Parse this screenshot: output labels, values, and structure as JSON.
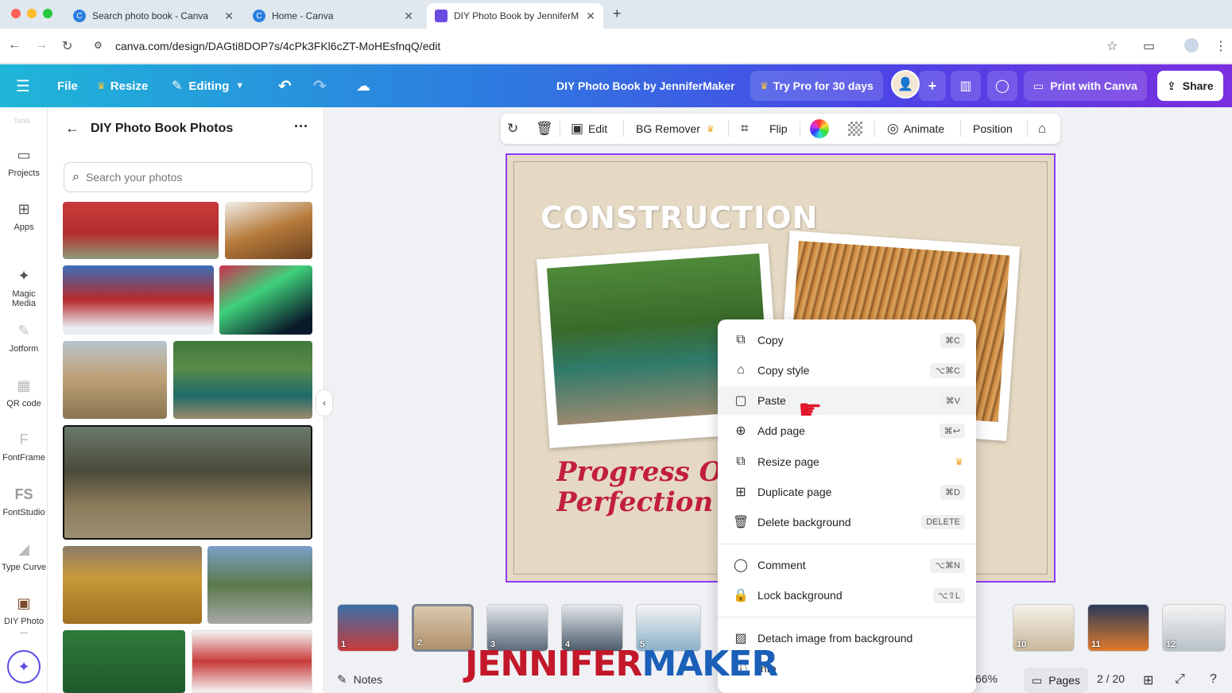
{
  "browser": {
    "tabs": [
      {
        "title": "Search photo book - Canva"
      },
      {
        "title": "Home - Canva"
      },
      {
        "title": "DIY Photo Book by JenniferM"
      }
    ],
    "url": "canva.com/design/DAGti8DOP7s/4cPk3FKl6cZT-MoHEsfnqQ/edit"
  },
  "header": {
    "file": "File",
    "resize": "Resize",
    "editing": "Editing",
    "design_title": "DIY Photo Book by JenniferMaker",
    "try_pro": "Try Pro for 30 days",
    "print": "Print with Canva",
    "share": "Share"
  },
  "rail": {
    "tools_label": "Tools",
    "items": [
      {
        "label": "Projects",
        "icon": "folder-icon"
      },
      {
        "label": "Apps",
        "icon": "apps-icon"
      },
      {
        "label": "Magic Media",
        "icon": "magic-media-icon"
      },
      {
        "label": "Jotform",
        "icon": "jotform-icon"
      },
      {
        "label": "QR code",
        "icon": "qr-code-icon"
      },
      {
        "label": "FontFrame",
        "icon": "fontframe-icon"
      },
      {
        "label": "FontStudio",
        "icon": "fontstudio-icon"
      },
      {
        "label": "Type Curve",
        "icon": "type-curve-icon"
      },
      {
        "label": "DIY Photo ...",
        "icon": "diy-photo-icon"
      }
    ]
  },
  "panel": {
    "title": "DIY Photo Book Photos",
    "search_placeholder": "Search your photos"
  },
  "toolbar": {
    "edit": "Edit",
    "bg_remover": "BG Remover",
    "flip": "Flip",
    "animate": "Animate",
    "position": "Position"
  },
  "canvas": {
    "title": "CONSTRUCTION",
    "quote_line1": "Progress Over",
    "quote_line2": "Perfection"
  },
  "context_menu": {
    "items": [
      {
        "label": "Copy",
        "shortcut": "⌘C",
        "icon": "copy-icon"
      },
      {
        "label": "Copy style",
        "shortcut": "⌥⌘C",
        "icon": "paint-roller-icon"
      },
      {
        "label": "Paste",
        "shortcut": "⌘V",
        "icon": "clipboard-icon"
      },
      {
        "label": "Add page",
        "shortcut": "⌘↩",
        "icon": "add-page-icon"
      },
      {
        "label": "Resize page",
        "shortcut": "",
        "icon": "resize-icon"
      },
      {
        "label": "Duplicate page",
        "shortcut": "⌘D",
        "icon": "duplicate-icon"
      },
      {
        "label": "Delete background",
        "shortcut": "DELETE",
        "icon": "trash-icon"
      },
      {
        "label": "Comment",
        "shortcut": "⌥⌘N",
        "icon": "comment-icon"
      },
      {
        "label": "Lock background",
        "shortcut": "⌥⇧L",
        "icon": "lock-icon"
      },
      {
        "label": "Detach image from background",
        "shortcut": "",
        "icon": "detach-icon"
      },
      {
        "label": "Info",
        "shortcut": "",
        "icon": "info-icon"
      }
    ]
  },
  "pages_strip": {
    "numbers": [
      "1",
      "2",
      "3",
      "4",
      "5",
      "10",
      "11",
      "12"
    ]
  },
  "bottom": {
    "notes": "Notes",
    "zoom": "66%",
    "pages": "Pages",
    "page_count": "2 / 20"
  },
  "watermark": {
    "part1": "JENNIFER",
    "part2": "MAKER"
  },
  "colors": {
    "accent": "#8b3dff",
    "quote_red": "#c21f3a",
    "crown": "#f2a31f"
  }
}
